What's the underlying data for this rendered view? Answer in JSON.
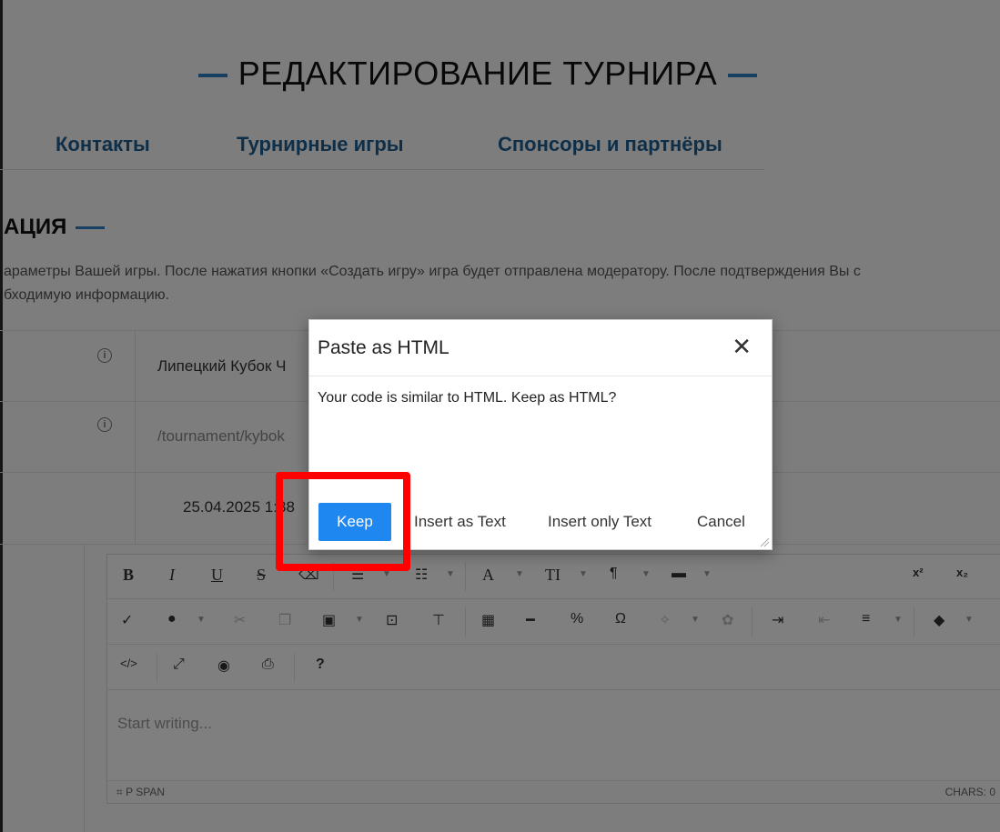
{
  "page": {
    "title": "РЕДАКТИРОВАНИЕ ТУРНИРА",
    "tabs": [
      "Контакты",
      "Турнирные игры",
      "Спонсоры и партнёры"
    ],
    "section_title": "АЦИЯ",
    "description_line1": "араметры Вашей игры. После нажатия кнопки «Создать игру» игра будет отправлена модератору. После подтверждения Вы с",
    "description_line2": "бходимую информацию."
  },
  "form": {
    "name_value": "Липецкий Кубок Ч",
    "url_value": "/tournament/kybok",
    "date_value": "25.04.2025 1",
    "time_fragment": ":38"
  },
  "editor": {
    "toolbar_row1": [
      "B",
      "I",
      "U",
      "S",
      "eraser-icon",
      "list-ul-icon",
      "list-ol-icon",
      "A",
      "TI",
      "¶",
      "align-icon",
      "x²",
      "x₂"
    ],
    "superscript": "x²",
    "subscript": "x₂",
    "omega": "Ω",
    "help": "?",
    "font_letter": "A",
    "font_size": "TI",
    "paragraph": "¶",
    "placeholder": "Start writing...",
    "status_path": "P  SPAN",
    "status_chars": "CHARS: 0"
  },
  "dialog": {
    "title": "Paste as HTML",
    "close_symbol": "✕",
    "message": "Your code is similar to HTML. Keep as HTML?",
    "buttons": {
      "keep": "Keep",
      "insert_as_text": "Insert as Text",
      "insert_only_text": "Insert only Text",
      "cancel": "Cancel"
    }
  },
  "colors": {
    "accent_blue": "#2f7fc4",
    "tab_blue": "#1f5f93",
    "primary_button": "#1e87f0",
    "highlight_red": "#ff0000",
    "overlay": "rgba(0,0,0,0.5)"
  }
}
